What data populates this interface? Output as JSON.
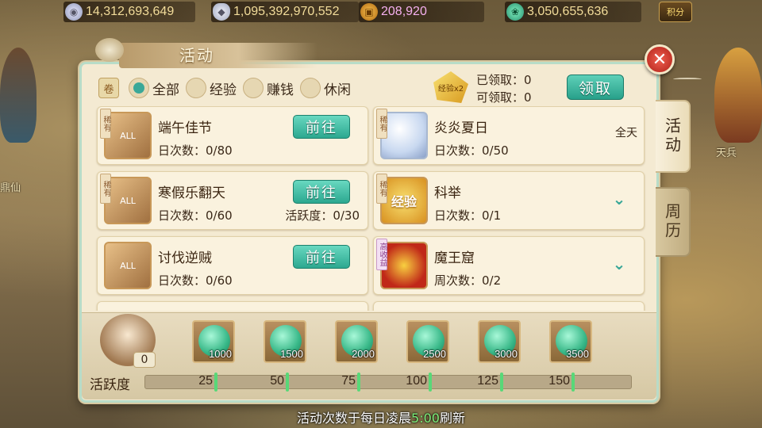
{
  "currencies": [
    {
      "icon": "silver-coin-icon",
      "value": "14,312,693,649"
    },
    {
      "icon": "silver-ingot-icon",
      "value": "1,095,392,970,552"
    },
    {
      "icon": "copper-coin-icon",
      "value": "208,920"
    },
    {
      "icon": "jade-icon",
      "value": "3,050,655,636"
    }
  ],
  "score_button": "积分",
  "background_labels": {
    "left": "鼎仙",
    "right": "天兵"
  },
  "panel": {
    "title": "活动",
    "filters": [
      {
        "label": "全部",
        "selected": true
      },
      {
        "label": "经验",
        "selected": false
      },
      {
        "label": "赚钱",
        "selected": false
      },
      {
        "label": "休闲",
        "selected": false
      }
    ],
    "claim": {
      "badge": "经验x2",
      "claimed": "已领取：0",
      "claimable": "可领取：0",
      "button": "领取"
    }
  },
  "activities": [
    {
      "name": "端午佳节",
      "tag": "稀有",
      "count": "日次数：0/80",
      "action": "前往",
      "thumb": "ALL"
    },
    {
      "name": "炎炎夏日",
      "tag": "稀有",
      "count": "日次数：0/50",
      "status": "全天",
      "thumb": ""
    },
    {
      "name": "寒假乐翻天",
      "tag": "稀有",
      "count": "日次数：0/60",
      "extra": "活跃度：0/30",
      "action": "前往",
      "thumb": "ALL"
    },
    {
      "name": "科举",
      "tag": "稀有",
      "count": "日次数：0/1",
      "thumb": "经验"
    },
    {
      "name": "讨伐逆贼",
      "count": "日次数：0/60",
      "action": "前往",
      "thumb": "ALL"
    },
    {
      "name": "魔王窟",
      "tag": "高收益",
      "count": "周次数：0/2",
      "thumb": ""
    }
  ],
  "rewards": {
    "current": "0",
    "items": [
      "1000",
      "1500",
      "2000",
      "2500",
      "3000",
      "3500"
    ]
  },
  "activity_bar": {
    "label": "活跃度",
    "progress": 0,
    "milestones": [
      "25",
      "50",
      "75",
      "100",
      "125",
      "150"
    ]
  },
  "tabs": [
    {
      "label": "活动",
      "active": true
    },
    {
      "label": "周历",
      "active": false
    }
  ],
  "footer": {
    "before": "活动次数于每日凌晨",
    "time": "5:00",
    "after": "刷新"
  },
  "colors": {
    "accent": "#2ca890",
    "panel": "#f4ead2",
    "close": "#c02818",
    "tick": "#58d878"
  }
}
